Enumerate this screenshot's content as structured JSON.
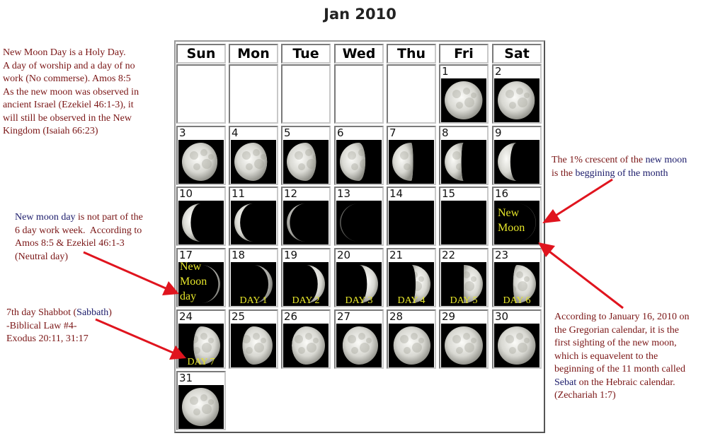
{
  "title": "Jan 2010",
  "weekdays": [
    "Sun",
    "Mon",
    "Tue",
    "Wed",
    "Thu",
    "Fri",
    "Sat"
  ],
  "days": [
    {
      "n": "1",
      "phase": 0.99,
      "waxing": false
    },
    {
      "n": "2",
      "phase": 0.97,
      "waxing": false
    },
    {
      "n": "3",
      "phase": 0.93,
      "waxing": false
    },
    {
      "n": "4",
      "phase": 0.86,
      "waxing": false
    },
    {
      "n": "5",
      "phase": 0.77,
      "waxing": false
    },
    {
      "n": "6",
      "phase": 0.67,
      "waxing": false
    },
    {
      "n": "7",
      "phase": 0.55,
      "waxing": false
    },
    {
      "n": "8",
      "phase": 0.44,
      "waxing": false
    },
    {
      "n": "9",
      "phase": 0.33,
      "waxing": false
    },
    {
      "n": "10",
      "phase": 0.23,
      "waxing": false
    },
    {
      "n": "11",
      "phase": 0.15,
      "waxing": false
    },
    {
      "n": "12",
      "phase": 0.08,
      "waxing": false
    },
    {
      "n": "13",
      "phase": 0.03,
      "waxing": false
    },
    {
      "n": "14",
      "phase": 0,
      "waxing": false
    },
    {
      "n": "15",
      "phase": 0,
      "waxing": false
    },
    {
      "n": "16",
      "phase": 0.01,
      "waxing": true,
      "label": [
        "New",
        "Moon"
      ]
    },
    {
      "n": "17",
      "phase": 0.05,
      "waxing": true,
      "label": [
        "New",
        "Moon",
        "day"
      ]
    },
    {
      "n": "18",
      "phase": 0.11,
      "waxing": true,
      "day_label": "DAY 1"
    },
    {
      "n": "19",
      "phase": 0.19,
      "waxing": true,
      "day_label": "DAY 2"
    },
    {
      "n": "20",
      "phase": 0.29,
      "waxing": true,
      "day_label": "DAY 3"
    },
    {
      "n": "21",
      "phase": 0.39,
      "waxing": true,
      "day_label": "DAY 4"
    },
    {
      "n": "22",
      "phase": 0.5,
      "waxing": true,
      "day_label": "DAY 5"
    },
    {
      "n": "23",
      "phase": 0.6,
      "waxing": true,
      "day_label": "DAY 6"
    },
    {
      "n": "24",
      "phase": 0.7,
      "waxing": true,
      "day_label": "DAY 7"
    },
    {
      "n": "25",
      "phase": 0.79,
      "waxing": true
    },
    {
      "n": "26",
      "phase": 0.87,
      "waxing": true
    },
    {
      "n": "27",
      "phase": 0.93,
      "waxing": true
    },
    {
      "n": "28",
      "phase": 0.97,
      "waxing": true
    },
    {
      "n": "29",
      "phase": 1.0,
      "waxing": true
    },
    {
      "n": "30",
      "phase": 0.99,
      "waxing": false
    },
    {
      "n": "31",
      "phase": 0.97,
      "waxing": false
    }
  ],
  "first_weekday_index": 5,
  "notes": {
    "holy_day": [
      "New Moon Day is a Holy Day.",
      "A day of worship and a day of no",
      "work (No commerse). Amos 8:5",
      "As the  new moon was observed in",
      "ancient Israel (Ezekiel 46:1-3), it",
      "will still be observed in the New",
      "Kingdom (Isaiah 66:23)"
    ],
    "neutral_day": {
      "line1_blue": "New moon day",
      "line1_rest": " is not part of the",
      "line2": "6 day work week.  According to",
      "line3": "Amos 8:5 & Ezekiel 46:1-3",
      "line4": "(Neutral day)"
    },
    "sabbath": {
      "line1_pre": "7th day Shabbot (",
      "line1_blue": "Sabbath",
      "line1_post": ")",
      "line2": "-Biblical Law #4-",
      "line3": "Exodus 20:11, 31:17"
    },
    "crescent": {
      "line1_red": "The 1% crescent of the ",
      "line1_blue": "new moon",
      "line2_red": "is the ",
      "line2_blue": "beggining of the month"
    },
    "sighting": {
      "line1": "According to January 16, 2010 on",
      "line2": "the Gregorian calendar, it is the",
      "line3": "first sighting of the new moon,",
      "line4": "which is equavelent to the",
      "line5": "beginning of the 11 month called",
      "line6_blue": "Sebat",
      "line6_rest": " on the Hebraic calendar.",
      "line7": "(Zechariah 1:7)"
    }
  },
  "colors": {
    "note_red": "#7a1515",
    "note_blue": "#1a1a6a",
    "label_yellow": "#e6e62a",
    "arrow_red": "#e0141e"
  }
}
